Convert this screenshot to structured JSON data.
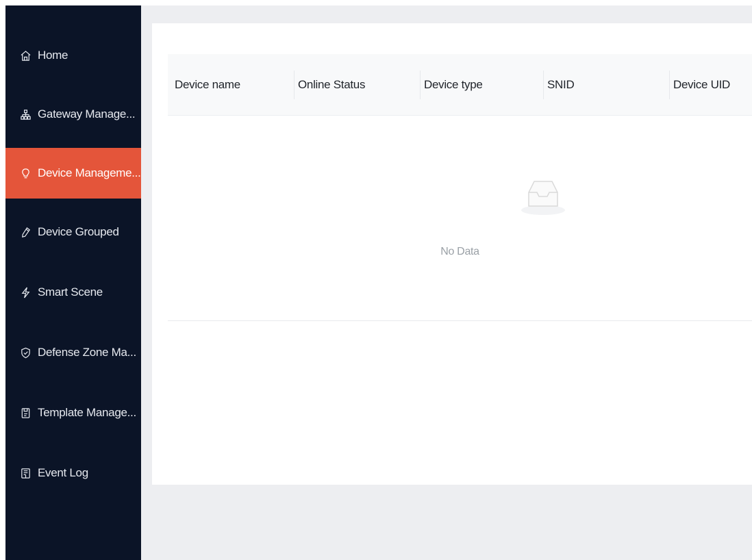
{
  "sidebar": {
    "items": [
      {
        "label": "Home",
        "icon": "home-icon",
        "active": false
      },
      {
        "label": "Gateway Manage...",
        "icon": "gateway-icon",
        "active": false
      },
      {
        "label": "Device Manageme...",
        "icon": "bulb-icon",
        "active": true
      },
      {
        "label": "Device Grouped",
        "icon": "group-icon",
        "active": false
      },
      {
        "label": "Smart Scene",
        "icon": "lightning-icon",
        "active": false
      },
      {
        "label": "Defense Zone Ma...",
        "icon": "shield-icon",
        "active": false
      },
      {
        "label": "Template Manage...",
        "icon": "template-icon",
        "active": false
      },
      {
        "label": "Event Log",
        "icon": "log-icon",
        "active": false
      }
    ]
  },
  "table": {
    "columns": [
      "Device name",
      "Online Status",
      "Device type",
      "SNID",
      "Device UID"
    ],
    "empty_text": "No Data"
  },
  "colors": {
    "sidebar_bg": "#0b1427",
    "active_bg": "#e4553a",
    "content_bg": "#edeef1"
  }
}
